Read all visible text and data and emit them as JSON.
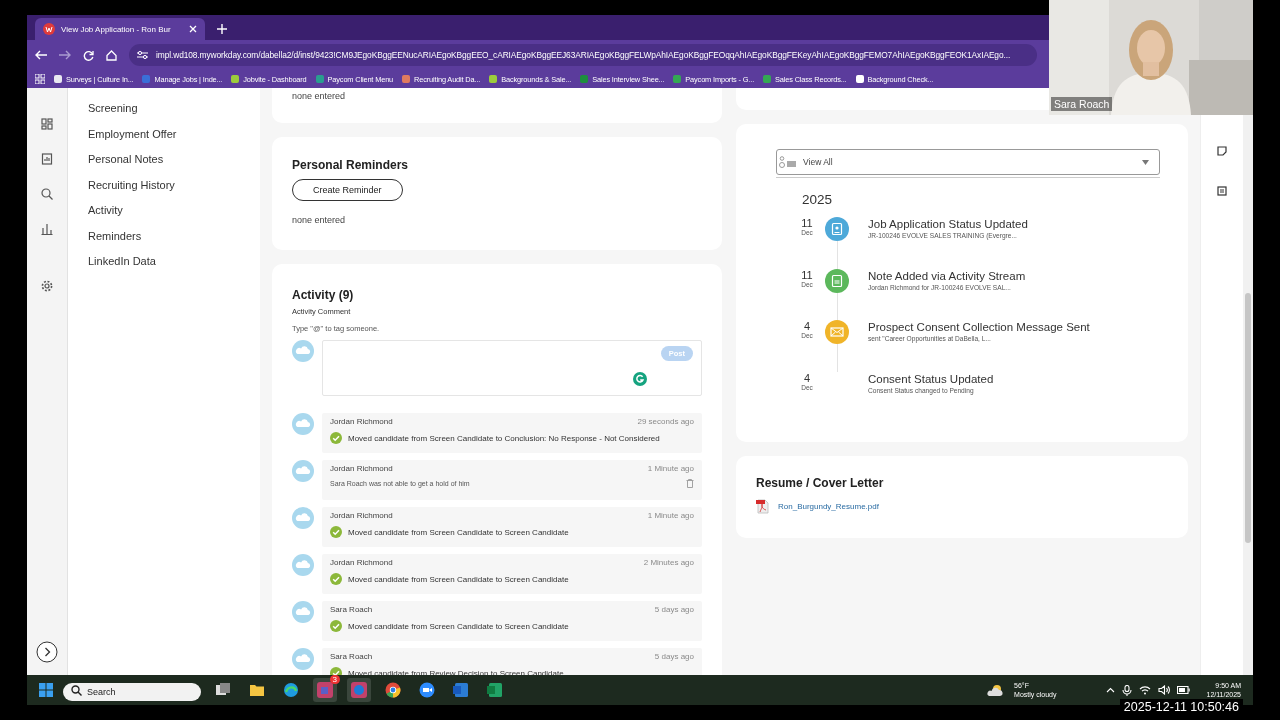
{
  "browser": {
    "tab_title": "View Job Application - Ron Bur",
    "url": "impl.wd108.myworkday.com/dabella2/d/inst/9423!CM9JEgoKBggEENucARIAEgoKBggEEO_cARIAEgoKBggEEJ63ARIAEgoKBggFELWpAhIAEgoKBggFEOqqAhIAEgoKBggFEKeyAhIAEgoKBggFEMO7AhIAEgoKBggFEOK1AxIAEgo...",
    "bookmarks": [
      {
        "label": "Surveys | Culture In...",
        "color": "#e8e8f0"
      },
      {
        "label": "Manage Jobs | Inde...",
        "color": "#3a6fd8"
      },
      {
        "label": "Jobvite - Dashboard",
        "color": "#9ccc3c"
      },
      {
        "label": "Paycom Client Menu",
        "color": "#2a9d8f"
      },
      {
        "label": "Recruiting Audit Da...",
        "color": "#e07a5f"
      },
      {
        "label": "Backgrounds & Sale...",
        "color": "#9ccc3c"
      },
      {
        "label": "Sales Interview Shee...",
        "color": "#1e8e3e"
      },
      {
        "label": "Paycom Imports - G...",
        "color": "#34a853"
      },
      {
        "label": "Sales Class Records...",
        "color": "#34a853"
      },
      {
        "label": "Background Check...",
        "color": "#ffffff"
      }
    ]
  },
  "sidebar": {
    "items": [
      {
        "label": "Screening"
      },
      {
        "label": "Employment Offer"
      },
      {
        "label": "Personal Notes"
      },
      {
        "label": "Recruiting History"
      },
      {
        "label": "Activity"
      },
      {
        "label": "Reminders"
      },
      {
        "label": "LinkedIn Data"
      }
    ]
  },
  "notes_card": {
    "empty_text": "none entered"
  },
  "reminders": {
    "title": "Personal Reminders",
    "button": "Create Reminder",
    "empty_text": "none entered"
  },
  "activity": {
    "title": "Activity (9)",
    "comment_label": "Activity Comment",
    "hint": "Type \"@\" to tag someone.",
    "post_button": {
      "label": "Post",
      "disabled": true
    },
    "entries": [
      {
        "author": "Jordan Richmond",
        "time": "29 seconds ago",
        "text": "Moved candidate from Screen Candidate to Conclusion: No Response - Not Considered",
        "kind": "status"
      },
      {
        "author": "Jordan Richmond",
        "time": "1 Minute ago",
        "text": "Sara Roach was not able to get a hold of him",
        "kind": "note"
      },
      {
        "author": "Jordan Richmond",
        "time": "1 Minute ago",
        "text": "Moved candidate from Screen Candidate to Screen Candidate",
        "kind": "status"
      },
      {
        "author": "Jordan Richmond",
        "time": "2 Minutes ago",
        "text": "Moved candidate from Screen Candidate to Screen Candidate",
        "kind": "status"
      },
      {
        "author": "Sara Roach",
        "time": "5 days ago",
        "text": "Moved candidate from Screen Candidate to Screen Candidate",
        "kind": "status"
      },
      {
        "author": "Sara Roach",
        "time": "5 days ago",
        "text": "Moved candidate from Review Decision to Screen Candidate",
        "kind": "status"
      }
    ]
  },
  "timeline": {
    "filter": "View All",
    "year": "2025",
    "events": [
      {
        "day": "11",
        "month": "Dec",
        "title": "Job Application Status Updated",
        "detail": "JR-100246 EVOLVE SALES TRAINING (Evergre...",
        "kind": "badge",
        "color": "#4ea9d9"
      },
      {
        "day": "11",
        "month": "Dec",
        "title": "Note Added via Activity Stream",
        "detail": "Jordan Richmond for JR-100246 EVOLVE SAL...",
        "kind": "note",
        "color": "#5cb85c"
      },
      {
        "day": "4",
        "month": "Dec",
        "title": "Prospect Consent Collection Message Sent",
        "detail": "sent \"Career Opportunities at DaBella, L...",
        "kind": "mail",
        "color": "#f0b429"
      },
      {
        "day": "4",
        "month": "Dec",
        "title": "Consent Status Updated",
        "detail": "Consent Status changed to Pending",
        "kind": "none"
      }
    ]
  },
  "resume": {
    "title": "Resume / Cover Letter",
    "file": "Ron_Burgundy_Resume.pdf"
  },
  "video": {
    "name": "Sara Roach"
  },
  "taskbar": {
    "search_placeholder": "Search",
    "teams_badge": "3",
    "temperature": "56°F",
    "weather": "Mostly cloudy",
    "time": "9:50 AM",
    "date": "12/11/2025"
  },
  "recording_timestamp": "2025-12-11 10:50:46"
}
